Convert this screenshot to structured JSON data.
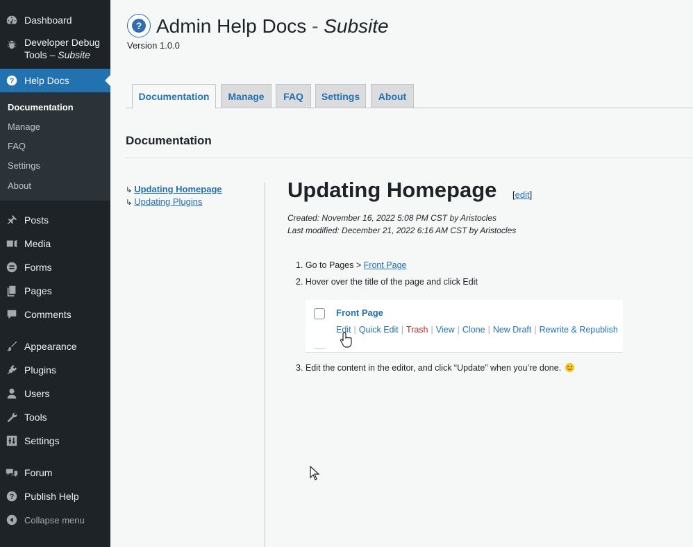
{
  "sidebar": {
    "top_items": [
      {
        "label": "Dashboard",
        "icon": "dashboard-icon"
      },
      {
        "label": "Developer Debug",
        "label2": "Tools – ",
        "label2_em": "Subsite",
        "icon": "bug-icon"
      },
      {
        "label": "Help Docs",
        "icon": "help-icon",
        "current": true
      }
    ],
    "submenu": [
      "Documentation",
      "Manage",
      "FAQ",
      "Settings",
      "About"
    ],
    "items": [
      {
        "label": "Posts",
        "icon": "pin-icon"
      },
      {
        "label": "Media",
        "icon": "media-icon"
      },
      {
        "label": "Forms",
        "icon": "forms-icon"
      },
      {
        "label": "Pages",
        "icon": "pages-icon"
      },
      {
        "label": "Comments",
        "icon": "comments-icon"
      },
      {
        "label": "Appearance",
        "icon": "brush-icon"
      },
      {
        "label": "Plugins",
        "icon": "plugin-icon"
      },
      {
        "label": "Users",
        "icon": "users-icon"
      },
      {
        "label": "Tools",
        "icon": "wrench-icon"
      },
      {
        "label": "Settings",
        "icon": "settings-icon"
      },
      {
        "label": "Forum",
        "icon": "forum-icon"
      },
      {
        "label": "Publish Help",
        "icon": "help-icon"
      },
      {
        "label": "Collapse menu",
        "icon": "collapse-icon"
      }
    ]
  },
  "header": {
    "title": "Admin Help Docs",
    "separator": "-",
    "subtitle": "Subsite",
    "version": "Version 1.0.0"
  },
  "tabs": [
    "Documentation",
    "Manage",
    "FAQ",
    "Settings",
    "About"
  ],
  "section_title": "Documentation",
  "toc": [
    "Updating Homepage",
    "Updating Plugins"
  ],
  "doc": {
    "title": "Updating Homepage",
    "edit_label": "edit",
    "created": "Created: November 16, 2022 5:08 PM CST by Aristocles",
    "modified": "Last modified: December 21, 2022 6:16 AM CST by Aristocles",
    "step1_prefix": "1. Go to Pages > ",
    "step1_link": "Front Page",
    "step2": "2. Hover over the title of the page and click Edit",
    "step3": "3. Edit the content in the editor, and click “Update” when you’re done.",
    "embed": {
      "row_title": "Front Page",
      "actions": [
        "Edit",
        "Quick Edit",
        "Trash",
        "View",
        "Clone",
        "New Draft",
        "Rewrite & Republish"
      ]
    }
  },
  "colors": {
    "sidebar_bg": "#1d2327",
    "accent": "#2271b1",
    "trash": "#b32d2e"
  }
}
